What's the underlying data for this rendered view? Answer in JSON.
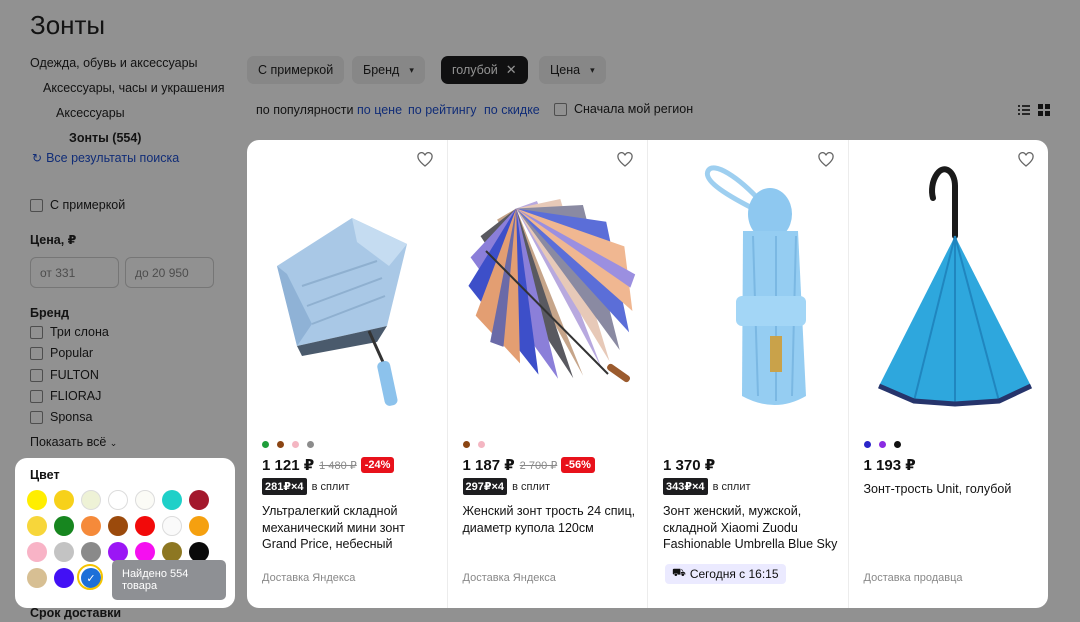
{
  "page_title": "Зонты",
  "breadcrumbs": [
    "Одежда, обувь и аксессуары",
    "Аксессуары, часы и украшения",
    "Аксессуары",
    "Зонты (554)"
  ],
  "all_results": "Все результаты поиска",
  "filters": {
    "try_on": "С примеркой",
    "price_heading": "Цена, ₽",
    "price_from_placeholder": "от 331",
    "price_to_placeholder": "до 20 950",
    "brand_heading": "Бренд",
    "brands": [
      "Три слона",
      "Popular",
      "FULTON",
      "FLIORAJ",
      "Sponsa"
    ],
    "show_all": "Показать всё",
    "delivery_heading": "Срок доставки"
  },
  "chips": [
    {
      "label": "С примеркой"
    },
    {
      "label": "Бренд"
    },
    {
      "label": "голубой"
    },
    {
      "label": "Цена"
    }
  ],
  "sort": {
    "popular": "по популярности",
    "price": "по цене",
    "rating": "по рейтингу",
    "discount": "по скидке",
    "region": "Сначала мой регион"
  },
  "products": [
    {
      "colors": [
        "#1f9e3a",
        "#8b4513",
        "#f4b6c2",
        "#8c8c8c"
      ],
      "price": "1 121 ₽",
      "old_price": "1 480 ₽",
      "discount": "-24%",
      "split": "281₽×4",
      "split_text": "в сплит",
      "name": "Ультралегкий складной механический мини зонт Grand Price, небесный",
      "delivery": "Доставка Яндекса"
    },
    {
      "colors": [
        "#8b4513",
        "#f4b6c2"
      ],
      "price": "1 187 ₽",
      "old_price": "2 700 ₽",
      "discount": "-56%",
      "split": "297₽×4",
      "split_text": "в сплит",
      "name": "Женский зонт трость 24 спиц, диаметр купола 120см",
      "delivery": "Доставка Яндекса"
    },
    {
      "colors": [],
      "price": "1 370 ₽",
      "split": "343₽×4",
      "split_text": "в сплит",
      "name": "Зонт женский, мужской, складной Xiaomi Zuodu Fashionable Umbrella Blue Sky",
      "delivery_badge": "Сегодня с 16:15"
    },
    {
      "colors": [
        "#2a25c9",
        "#8a2be2",
        "#111111"
      ],
      "price": "1 193 ₽",
      "name": "Зонт-трость Unit, голубой",
      "delivery": "Доставка продавца"
    }
  ],
  "color_panel": {
    "heading": "Цвет",
    "colors": [
      "#ffee00",
      "#f7d11a",
      "#eef2d6",
      "#ffffff",
      "#fbfbf6",
      "#1fd0c8",
      "#a3182c",
      "#f7d63a",
      "#17861f",
      "#f58a3a",
      "#9b4a0c",
      "#f20a0a",
      "#fafafa",
      "#f5a00f",
      "#f8b3c6",
      "#c3c3c3",
      "#8a8a8a",
      "#9b16f5",
      "#f50ff0",
      "#8d7722",
      "#0a0a0a",
      "#d7bf93",
      "#4210f5",
      "#1d6fd8"
    ],
    "selected_index": 23,
    "tooltip": "Найдено 554 товара"
  }
}
